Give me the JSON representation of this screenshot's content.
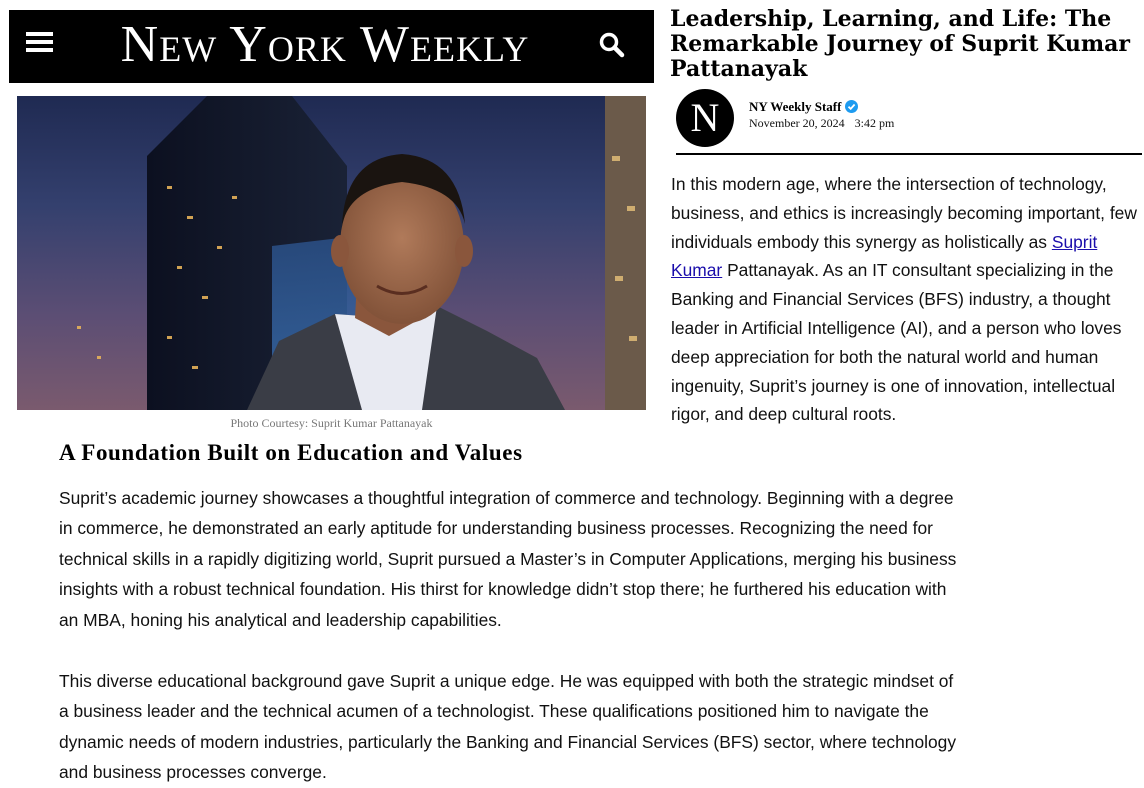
{
  "masthead": {
    "logo": "New York Weekly",
    "menu_icon": "hamburger-menu-icon",
    "search_icon": "search-icon"
  },
  "hero": {
    "caption": "Photo Courtesy: Suprit Kumar Pattanayak"
  },
  "article": {
    "headline": "Leadership, Learning, and Life: The Remarkable Journey of Suprit Kumar Pattanayak",
    "byline": {
      "avatar_letter": "N",
      "author": "NY Weekly Staff",
      "verified_icon": "verified-badge-icon",
      "date": "November 20, 2024",
      "time": "3:42 pm"
    },
    "intro": {
      "before_link": "In this modern age, where the intersection of technology, business, and ethics is increasingly becoming important, few individuals embody this synergy as holistically as ",
      "link_text": "Suprit Kumar",
      "after_link": " Pattanayak. As an IT consultant specializing in the Banking and Financial Services (BFS) industry, a thought leader in Artificial Intelligence (AI), and a person who loves deep appreciation for both the natural world and human ingenuity, Suprit’s journey is one of innovation, intellectual rigor, and deep cultural roots."
    },
    "section_heading": "A Foundation Built on Education and Values",
    "paragraphs": [
      "Suprit’s academic journey showcases a thoughtful integration of commerce and technology. Beginning with a degree in commerce, he demonstrated an early aptitude for understanding business processes. Recognizing the need for technical skills in a rapidly digitizing world, Suprit pursued a Master’s in Computer Applications, merging his business insights with a robust technical foundation. His thirst for knowledge didn’t stop there; he furthered his education with an MBA, honing his analytical and leadership capabilities.",
      "This diverse educational background gave Suprit a unique edge. He was equipped with both the strategic mindset of a business leader and the technical acumen of a technologist. These qualifications positioned him to navigate the dynamic needs of modern industries, particularly the Banking and Financial Services (BFS) sector, where technology and business processes converge."
    ]
  },
  "colors": {
    "masthead_bg": "#000000",
    "link": "#1a0dab",
    "verified": "#1d9bf0"
  }
}
